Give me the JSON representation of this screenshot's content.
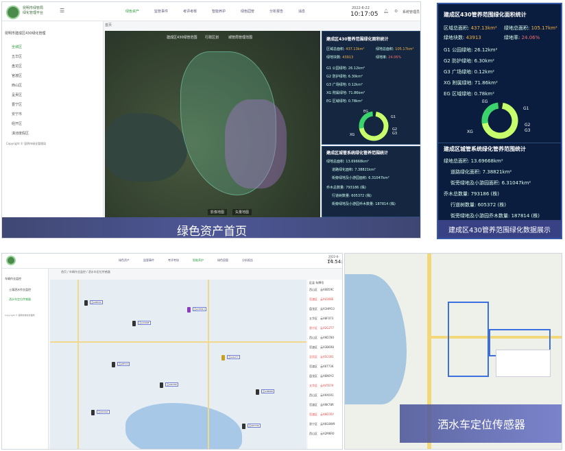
{
  "top": {
    "app": {
      "name_line1": "昆明市绿管局",
      "name_line2": "绿化管理平台"
    },
    "menu": [
      "绿色资产",
      "监管事件",
      "考评考核",
      "智能养护",
      "绿色园管",
      "分析报告",
      "消息"
    ],
    "date": "2022-6-22",
    "time": "10:17:05",
    "user": "系统管理员",
    "sidebar_header": "昆明市建成区430绿化管理",
    "sidebar_items": [
      "全城区",
      "五华区",
      "盘龙区",
      "官渡区",
      "西山区",
      "呈贡区",
      "晋宁区",
      "安宁市",
      "经开区",
      "滇池度假区"
    ],
    "copyright": "Copyright © 昆明市绿化管理局",
    "breadcrumb": "首页",
    "map_tabs": [
      "建成区430绿管范围",
      "行政区划",
      "城管局管理范围"
    ],
    "map_buttons": [
      "影像地图",
      "矢量地图"
    ],
    "panel1": {
      "title": "建成区430管养范围绿化面积统计",
      "area_label": "区域总面积:",
      "area_value": "437.13km²",
      "green_label": "绿地总面积:",
      "green_value": "105.17km²",
      "count_label": "绿地块数:",
      "count_value": "43913",
      "rate_label": "绿地率:",
      "rate_value": "24.06%",
      "items": [
        "G1 公园绿地: 26.12km²",
        "G2 防护绿地: 6.30km²",
        "G3 广场绿地: 0.12km²",
        "XG 附属绿地: 71.86km²",
        "EG 区域绿地: 0.78km²"
      ],
      "donut_labels": [
        "EG",
        "G1",
        "G2",
        "G3",
        "XG"
      ]
    },
    "panel2": {
      "title": "建成区城管系统绿化管养范围统计",
      "items": [
        "绿地总面积: 13.69668km²",
        "道路绿化面积: 7.38821km²",
        "街旁绿地及小游园面积: 6.31047km²",
        "乔木总数量: 793186 (株)",
        "行道树数量: 605372 (株)",
        "街旁绿地及小游园乔木数量: 187814 (株)"
      ]
    },
    "caption": "绿色资产首页",
    "zoom_caption": "建成区430管养范围绿化数据展示"
  },
  "bottom": {
    "menu": [
      "绿色资产",
      "监管事件",
      "考评考核",
      "智能养护",
      "绿色园管",
      "分析报告"
    ],
    "date": "2022-6-22",
    "time": "14:54:49",
    "sidebar_items": [
      "车辆作业监控",
      "土壤洒水作业监控",
      "洒水车定位传感器"
    ],
    "copyright": "Copyright © 昆明市绿化管理局",
    "breadcrumb": [
      "首页",
      "车辆作业监控",
      "洒水车定位传感器"
    ],
    "list_header": "区县 车牌号",
    "list_rows": [
      {
        "district": "西山区",
        "plate": "云A0B59C"
      },
      {
        "district": "官渡区",
        "plate": "云A4306E"
      },
      {
        "district": "盘龙区",
        "plate": "云A1HM13"
      },
      {
        "district": "五华区",
        "plate": "云A8F073"
      },
      {
        "district": "晋宁区",
        "plate": "云A2G2T7"
      },
      {
        "district": "西山区",
        "plate": "云A9D780"
      },
      {
        "district": "官渡区",
        "plate": "云A3B6R8"
      },
      {
        "district": "呈贡区",
        "plate": "云A5C001"
      },
      {
        "district": "官渡区",
        "plate": "云A6T736"
      },
      {
        "district": "盘龙区",
        "plate": "云A6N9Y2"
      },
      {
        "district": "五华区",
        "plate": "云A4TE79"
      },
      {
        "district": "西山区",
        "plate": "云A9X001"
      },
      {
        "district": "官渡区",
        "plate": "云A9K78R"
      },
      {
        "district": "官渡区",
        "plate": "云A9D76Y"
      },
      {
        "district": "晋宁区",
        "plate": "云A6G8W9"
      },
      {
        "district": "西山区",
        "plate": "云A2M6R0"
      }
    ],
    "caption": "洒水车定位传感器"
  }
}
